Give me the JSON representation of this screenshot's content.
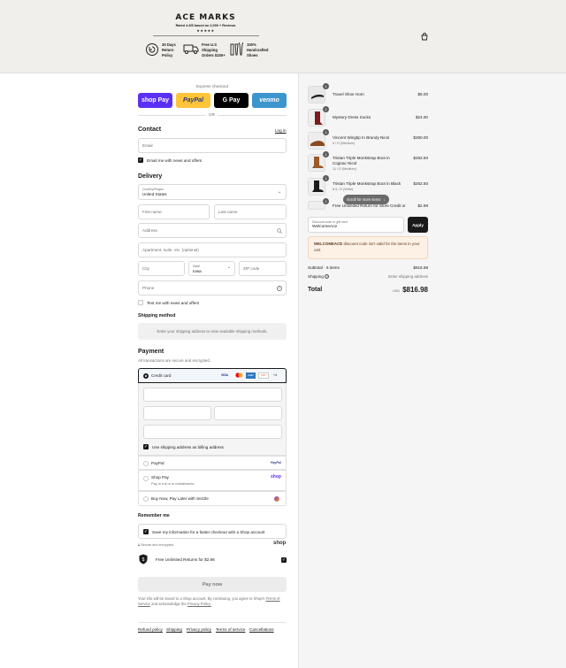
{
  "brand": {
    "name": "ACE MARKS",
    "rating": "Rated 4.8/5 based on 2,090 + Reviews",
    "stars": "★★★★★",
    "perks": [
      {
        "icon": "return-icon",
        "text": "30 Days Return Policy"
      },
      {
        "icon": "truck-icon",
        "text": "Free U.S Shipping Orders $150+"
      },
      {
        "icon": "tools-icon",
        "text": "100% Handcrafted Shoes"
      }
    ]
  },
  "express": {
    "title": "Express checkout",
    "buttons": [
      {
        "label": "shop Pay",
        "color": "#5a31f4"
      },
      {
        "label": "PayPal",
        "color": "#ffc439"
      },
      {
        "label": "G Pay",
        "color": "#000000"
      },
      {
        "label": "venmo",
        "color": "#3d95ce"
      }
    ],
    "or": "OR"
  },
  "contact": {
    "title": "Contact",
    "login": "Log in",
    "email_placeholder": "Email",
    "news_label": "Email me with news and offers"
  },
  "delivery": {
    "title": "Delivery",
    "country_label": "Country/Region",
    "country_value": "United States",
    "first_name": "First name",
    "last_name": "Last name",
    "address": "Address",
    "apartment": "Apartment, suite, etc. (optional)",
    "city": "City",
    "state_label": "State",
    "state_value": "Iowa",
    "zip": "ZIP code",
    "phone": "Phone",
    "text_label": "Text me with news and offers"
  },
  "shipping": {
    "title": "Shipping method",
    "notice": "Enter your shipping address to view available shipping methods."
  },
  "payment": {
    "title": "Payment",
    "subtitle": "All transactions are secure and encrypted.",
    "credit_card": "Credit card",
    "card_brands": [
      "VISA",
      "MC",
      "AMEX",
      "DISC",
      "+4"
    ],
    "billing_label": "Use shipping address as billing address",
    "paypal": "PayPal",
    "paypal_logo": "PayPal",
    "shop_pay": "Shop Pay",
    "shop_pay_sub": "Pay in full or in installments",
    "shop_logo": "shop",
    "sezzle": "Buy Now, Pay Later with Sezzle"
  },
  "remember": {
    "title": "Remember me",
    "save_label": "Save my information for a faster checkout with a Shop account",
    "secure": "Secure and encrypted",
    "shop_logo": "shop",
    "returns_label": "Free Unlimited Returns for $2.98"
  },
  "pay_button": "Pay now",
  "legal": {
    "text1": "Your info will be saved to a Shop account. By continuing, you agree to Shop's",
    "terms": "Terms of Service",
    "text2": "and acknowledge the",
    "privacy": "Privacy Policy."
  },
  "footer_links": [
    "Refund policy",
    "Shipping",
    "Privacy policy",
    "Terms of service",
    "Cancellations"
  ],
  "summary": {
    "items": [
      {
        "qty": "1",
        "name": "Travel Shoe Horn",
        "variant": "",
        "price": "$5.00"
      },
      {
        "qty": "1",
        "name": "Mystery Dress Socks",
        "variant": "",
        "price": "$24.00"
      },
      {
        "qty": "1",
        "name": "Vincent Wingtip In Brandy Nicol",
        "variant": "6 / D (Medium)",
        "price": "$260.00"
      },
      {
        "qty": "1",
        "name": "Tristan Triple Monkstrap Boot in Cognac Nicol",
        "variant": "11 / D (Medium)",
        "price": "$262.50"
      },
      {
        "qty": "1",
        "name": "Tristan Triple Monkstrap Boot in Black",
        "variant": "8.5 / E (Wide)",
        "price": "$262.50"
      },
      {
        "qty": "1",
        "name": "Free Unlimited Return for Store Credit or",
        "variant": "",
        "price": "$2.98"
      }
    ],
    "scroll_hint": "Scroll for more items",
    "discount_label": "Discount code or gift card",
    "discount_value": "WelcomeAce",
    "apply": "Apply",
    "error_code": "WELCOMEACE",
    "error_text": "discount code isn't valid for the items in your cart",
    "subtotal_label": "Subtotal · 6 items",
    "subtotal_value": "$816.98",
    "shipping_label": "Shipping",
    "shipping_value": "Enter shipping address",
    "total_label": "Total",
    "currency": "USD",
    "total_value": "$816.98"
  }
}
